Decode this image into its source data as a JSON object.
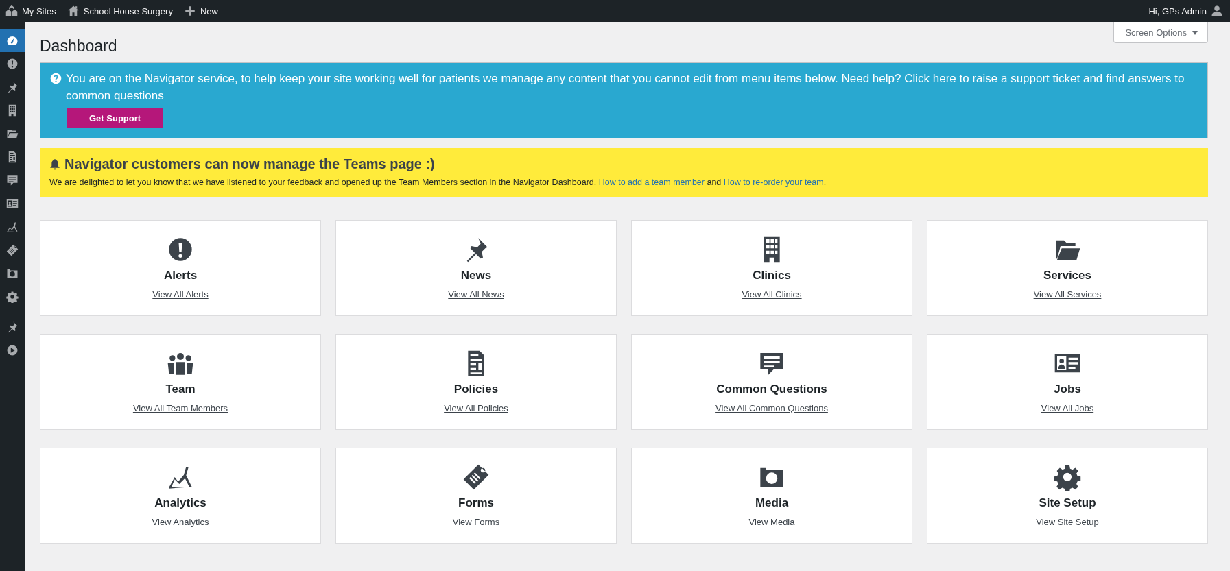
{
  "top_bar": {
    "items": [
      {
        "label": "My Sites"
      },
      {
        "label": "School House Surgery"
      },
      {
        "label": "New"
      }
    ],
    "account": "Hi, GPs Admin"
  },
  "sidebar": {
    "items": [
      {
        "selected": true
      },
      {
        "selected": false
      },
      {
        "selected": false
      },
      {
        "selected": false
      },
      {
        "selected": false
      },
      {
        "selected": false
      },
      {
        "selected": false
      },
      {
        "selected": false
      },
      {
        "selected": false
      },
      {
        "selected": false
      },
      {
        "selected": false
      },
      {
        "selected": false
      },
      {
        "selected": false
      },
      {
        "selected": false
      }
    ]
  },
  "page_title": "Dashboard",
  "screen_options": "Screen Options",
  "support_notice": {
    "text": "You are on the Navigator service, to help keep your site working well for patients we manage any content that you cannot edit from menu items below. Need help? Click here to raise a support ticket and find answers to common questions",
    "button": "Get Support"
  },
  "teams_notice": {
    "title": "Navigator customers can now manage the Teams page :)",
    "text": "We are delighted to let you know that we have listened to your feedback and opened up the Team Members section in the Navigator Dashboard.",
    "link_1": "How to add a team member",
    "joiner": "and",
    "link_2": "How to re-order your team",
    "end": "."
  },
  "cards": [
    {
      "title": "Alerts",
      "link": "View All Alerts"
    },
    {
      "title": "News",
      "link": "View All News"
    },
    {
      "title": "Clinics",
      "link": "View All Clinics"
    },
    {
      "title": "Services",
      "link": "View All Services"
    },
    {
      "title": "Team",
      "link": "View All Team Members"
    },
    {
      "title": "Policies",
      "link": "View All Policies"
    },
    {
      "title": "Common Questions",
      "link": "View All Common Questions"
    },
    {
      "title": "Jobs",
      "link": "View All Jobs"
    },
    {
      "title": "Analytics",
      "link": "View Analytics"
    },
    {
      "title": "Forms",
      "link": "View Forms"
    },
    {
      "title": "Media",
      "link": "View Media"
    },
    {
      "title": "Site Setup",
      "link": "View Site Setup"
    }
  ]
}
